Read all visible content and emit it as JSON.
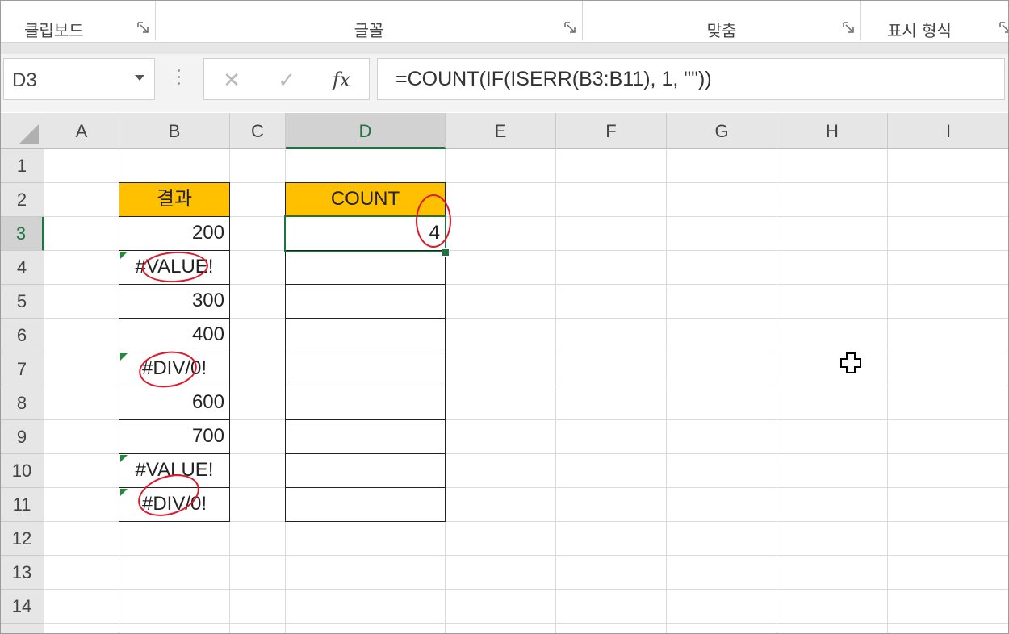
{
  "ribbon": {
    "groups": [
      {
        "label": "클립보드"
      },
      {
        "label": "글꼴"
      },
      {
        "label": "맞춤"
      },
      {
        "label": "표시 형식"
      }
    ]
  },
  "formula_bar": {
    "name_box": "D3",
    "cancel_glyph": "✕",
    "enter_glyph": "✓",
    "fx_label": "fx",
    "formula": "=COUNT(IF(ISERR(B3:B11), 1, \"\"))"
  },
  "sheet": {
    "columns": [
      "A",
      "B",
      "C",
      "D",
      "E",
      "F",
      "G",
      "H",
      "I"
    ],
    "selected_column": "D",
    "rows": [
      "1",
      "2",
      "3",
      "4",
      "5",
      "6",
      "7",
      "8",
      "9",
      "10",
      "11",
      "12",
      "13",
      "14"
    ],
    "selected_row": "3",
    "result_header": "결과",
    "result_values": [
      "200",
      "#VALUE!",
      "300",
      "400",
      "#DIV/0!",
      "600",
      "700",
      "#VALUE!",
      "#DIV/0!"
    ],
    "count_header": "COUNT",
    "count_value": "4",
    "active_cell": "D3"
  },
  "colors": {
    "header_fill": "#ffc000",
    "accent_green": "#217346",
    "annotation_red": "#e0192a"
  },
  "icons": {
    "cursor": "cell-select-cross-cursor-icon",
    "select_all": "select-all-triangle-icon"
  }
}
